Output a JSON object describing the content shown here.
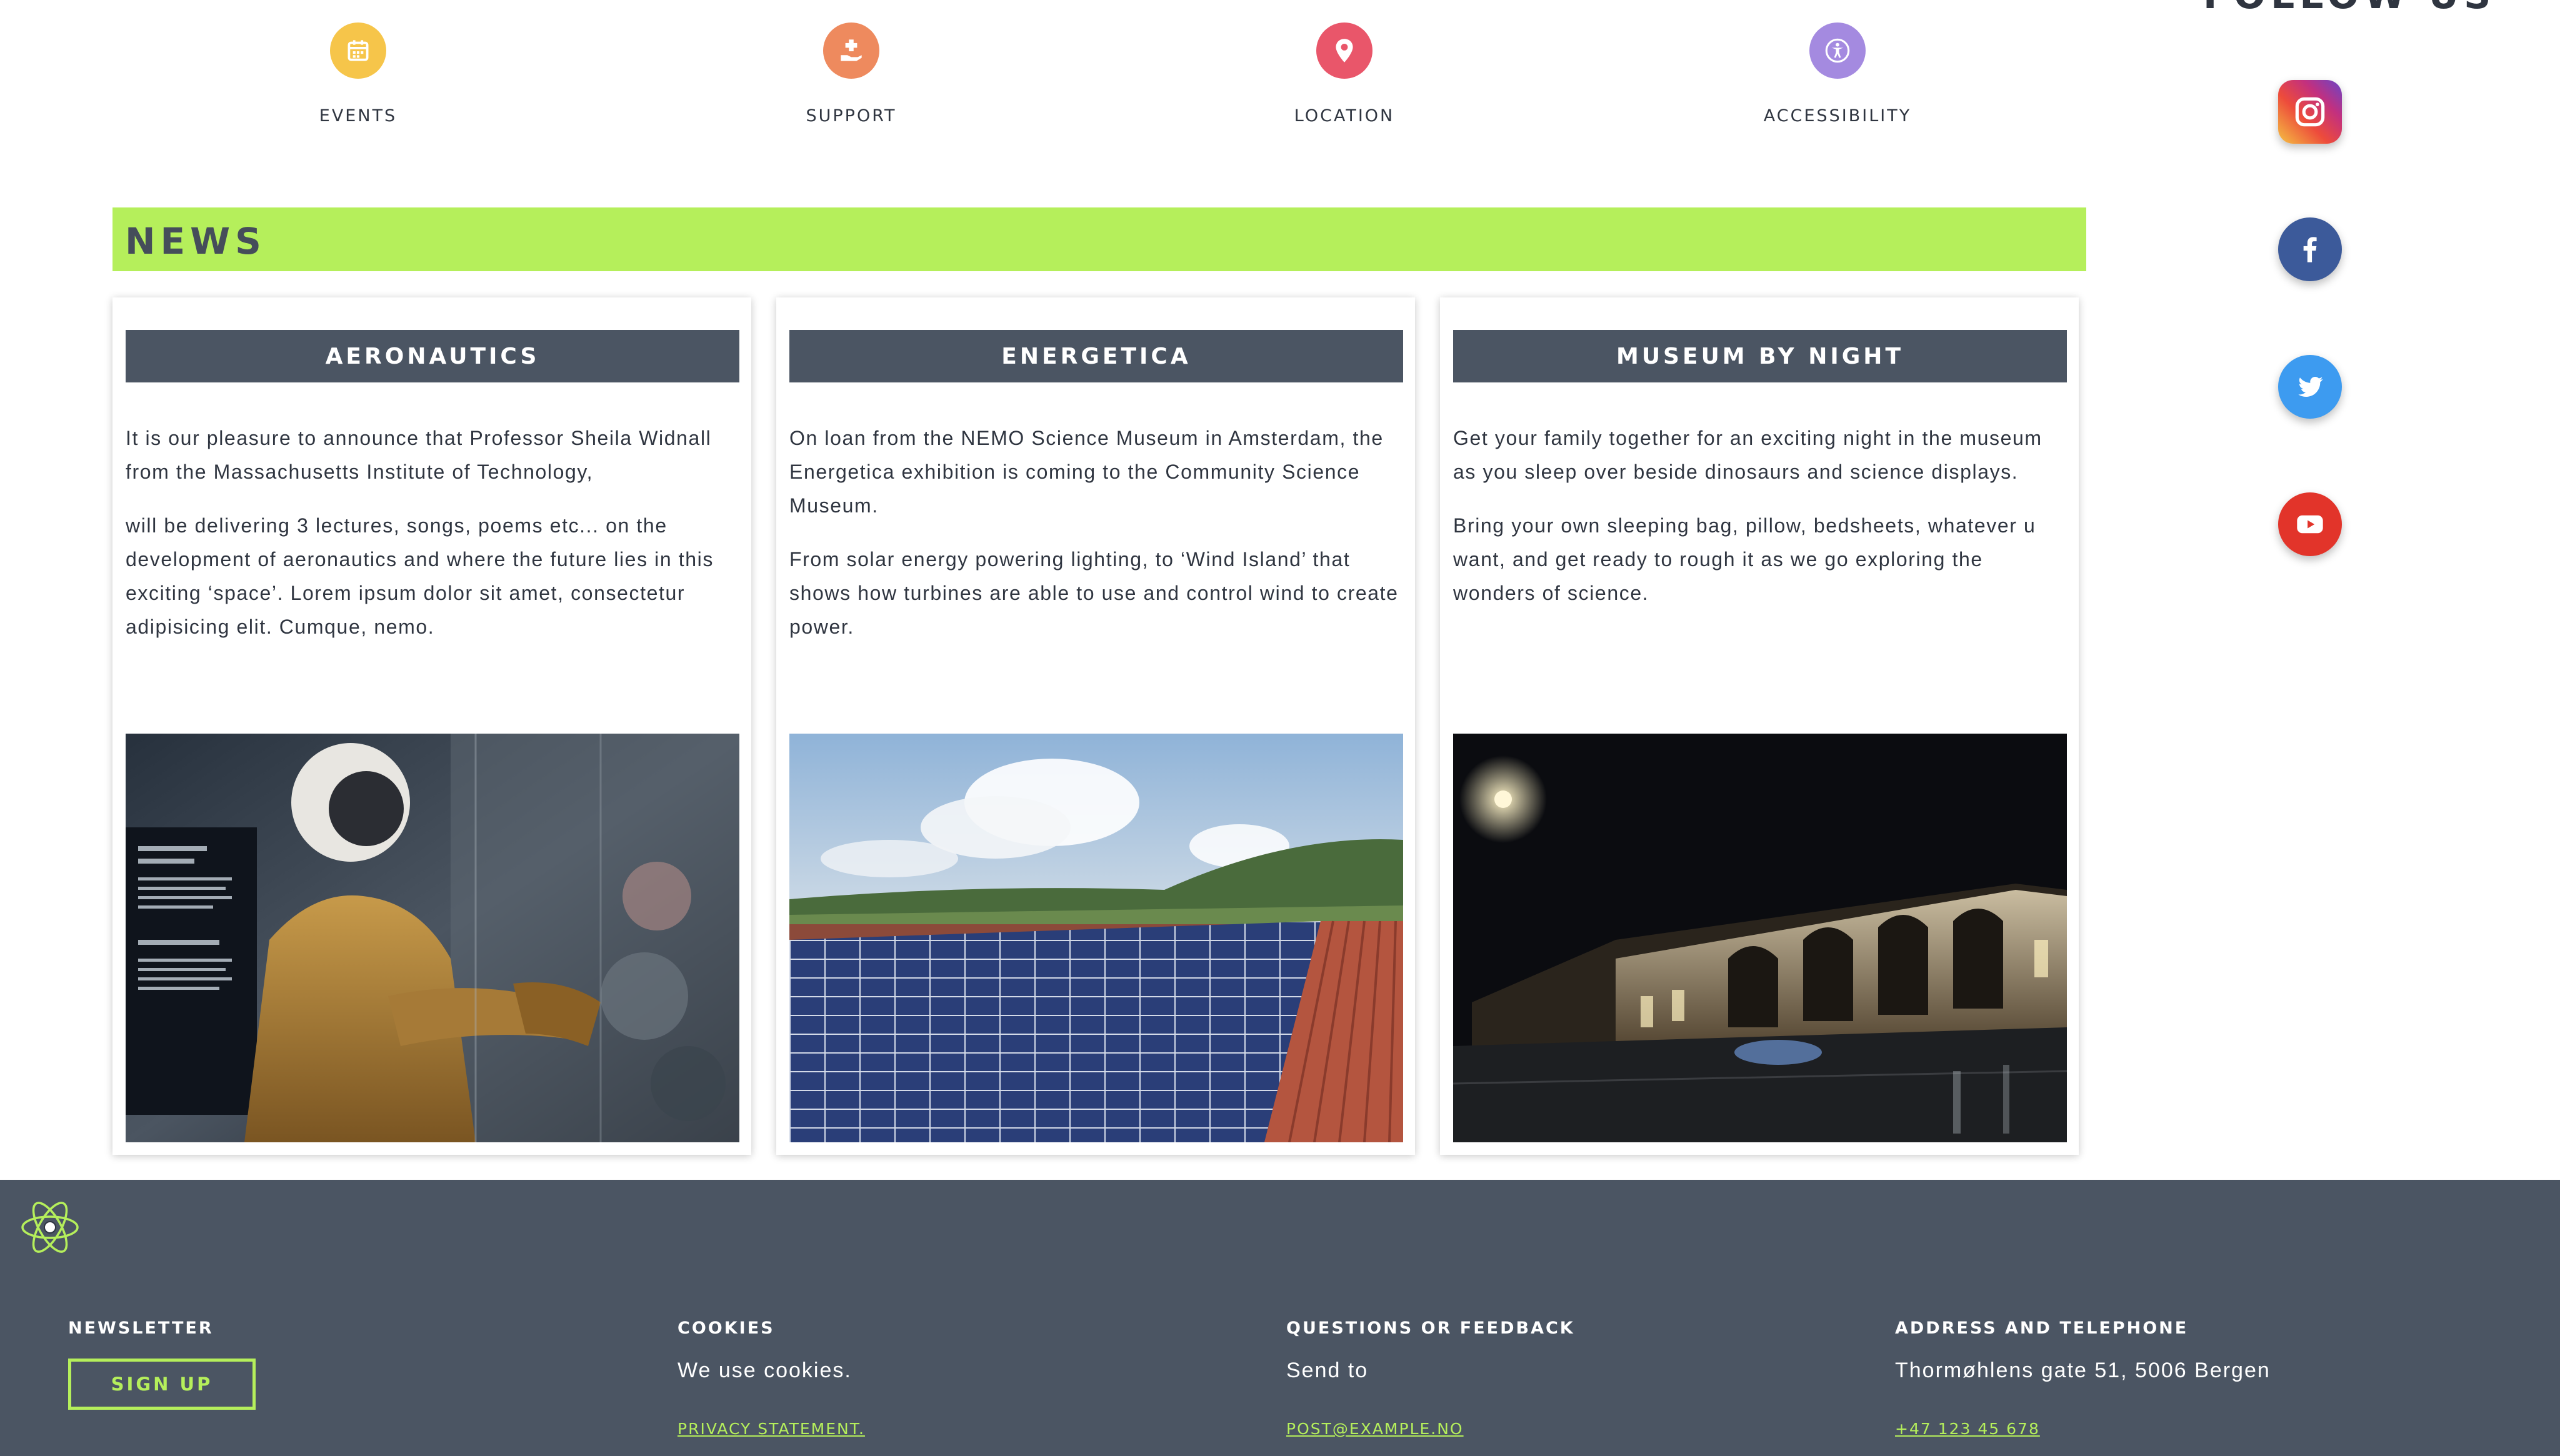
{
  "quick_links": [
    {
      "label": "EVENTS",
      "icon": "calendar-icon",
      "color": "#f6c54a"
    },
    {
      "label": "SUPPORT",
      "icon": "hand-plus-icon",
      "color": "#ee8a5e"
    },
    {
      "label": "LOCATION",
      "icon": "map-pin-icon",
      "color": "#e9566a"
    },
    {
      "label": "ACCESSIBILITY",
      "icon": "accessibility-icon",
      "color": "#a48ae0"
    }
  ],
  "follow": {
    "title": "FOLLOW US",
    "networks": [
      {
        "name": "instagram",
        "icon": "instagram-icon"
      },
      {
        "name": "facebook",
        "icon": "facebook-icon"
      },
      {
        "name": "twitter",
        "icon": "twitter-icon"
      },
      {
        "name": "youtube",
        "icon": "youtube-icon"
      }
    ]
  },
  "news": {
    "title": "NEWS",
    "cards": [
      {
        "title": "AERONAUTICS",
        "paragraphs": [
          "It is our pleasure to announce that Professor Sheila Widnall from the Massachusetts Institute of Technology,",
          "will be delivering 3 lectures, songs, poems etc... on the development of aeronautics and where the future lies in this exciting ‘space’. Lorem ipsum dolor sit amet, consectetur adipisicing elit. Cumque, nemo."
        ],
        "image": "astronaut-suit-exhibit-photo"
      },
      {
        "title": "ENERGETICA",
        "paragraphs": [
          "On loan from the NEMO Science Museum in Amsterdam, the Energetica exhibition is coming to the Community Science Museum.",
          "From solar energy powering lighting, to ‘Wind Island’ that shows how turbines are able to use and control wind to create power."
        ],
        "image": "solar-panels-roof-photo"
      },
      {
        "title": "MUSEUM BY NIGHT",
        "paragraphs": [
          "Get your family together for an exciting night in the museum as you sleep over beside dinosaurs and science displays.",
          "Bring your own sleeping bag, pillow, bedsheets, whatever u want, and get ready to rough it as we go exploring the wonders of science."
        ],
        "image": "museum-at-night-photo"
      }
    ]
  },
  "footer": {
    "newsletter": {
      "heading": "NEWSLETTER",
      "button": "SIGN UP"
    },
    "cookies": {
      "heading": "COOKIES",
      "text": "We use cookies.",
      "link": "PRIVACY STATEMENT."
    },
    "feedback": {
      "heading": "QUESTIONS OR FEEDBACK",
      "text": "Send to",
      "link": "POST@EXAMPLE.NO"
    },
    "address": {
      "heading": "ADDRESS AND TELEPHONE",
      "text": "Thormøhlens gate 51, 5006 Bergen",
      "link": "+47 123 45 678"
    }
  },
  "colors": {
    "accent": "#b5ef5b",
    "header_bg": "#4b5563",
    "footer_bg": "#4b5563",
    "text": "#2f3540"
  }
}
